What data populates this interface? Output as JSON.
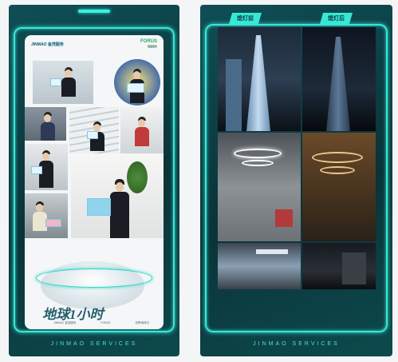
{
  "left_poster": {
    "logo_left": "JINMAO 金茂服务",
    "logo_right_main": "FORUS",
    "logo_right_sub": "慧盛服务",
    "title": "地球1小时",
    "sub_logos": [
      "JINMAO 金茂服务",
      "FORUS",
      "世界地球日"
    ],
    "footer": "JINMAO SERVICES"
  },
  "right_poster": {
    "tag_before": "熄灯前",
    "tag_after": "熄灯后",
    "footer": "JINMAO SERVICES"
  },
  "colors": {
    "accent": "#37e8d6",
    "frame_bg": "#0a3339"
  }
}
